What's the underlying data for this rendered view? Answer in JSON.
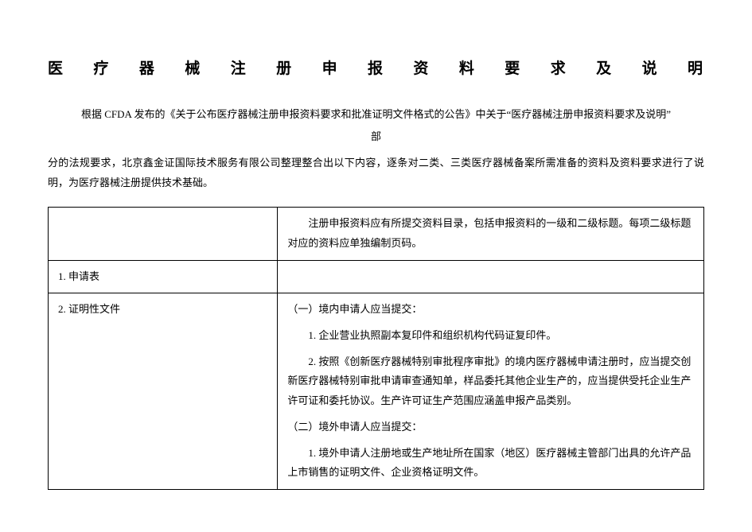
{
  "title": "医 疗 器 械 注 册 申 报 资 料 要 求 及 说 明",
  "intro": {
    "line1": "根据 CFDA 发布的《关于公布医疗器械注册申报资料要求和批准证明文件格式的公告》中关于“医疗器械注册申报资料要求及说明”",
    "line1_sub": "部",
    "para2": "分的法规要求，北京鑫金证国际技术服务有限公司整理整合出以下内容，逐条对二类、三类医疗器械备案所需准备的资料及资料要求进行了说明，为医疗器械注册提供技术基础。"
  },
  "table": {
    "row0": {
      "left": "",
      "right": "注册申报资料应有所提交资料目录，包括申报资料的一级和二级标题。每项二级标题对应的资料应单独编制页码。"
    },
    "row1": {
      "left": "1. 申请表",
      "right": ""
    },
    "row2": {
      "left": "2. 证明性文件",
      "r_h1": "（一）境内申请人应当提交：",
      "r_p1": "1. 企业营业执照副本复印件和组织机构代码证复印件。",
      "r_p2": "2. 按照《创新医疗器械特别审批程序审批》的境内医疗器械申请注册时，应当提交创新医疗器械特别审批申请审查通知单，样品委托其他企业生产的，应当提供受托企业生产许可证和委托协议。生产许可证生产范围应涵盖申报产品类别。",
      "r_h2": "（二）境外申请人应当提交：",
      "r_p3": "1. 境外申请人注册地或生产地址所在国家（地区）医疗器械主管部门出具的允许产品上市销售的证明文件、企业资格证明文件。"
    }
  }
}
